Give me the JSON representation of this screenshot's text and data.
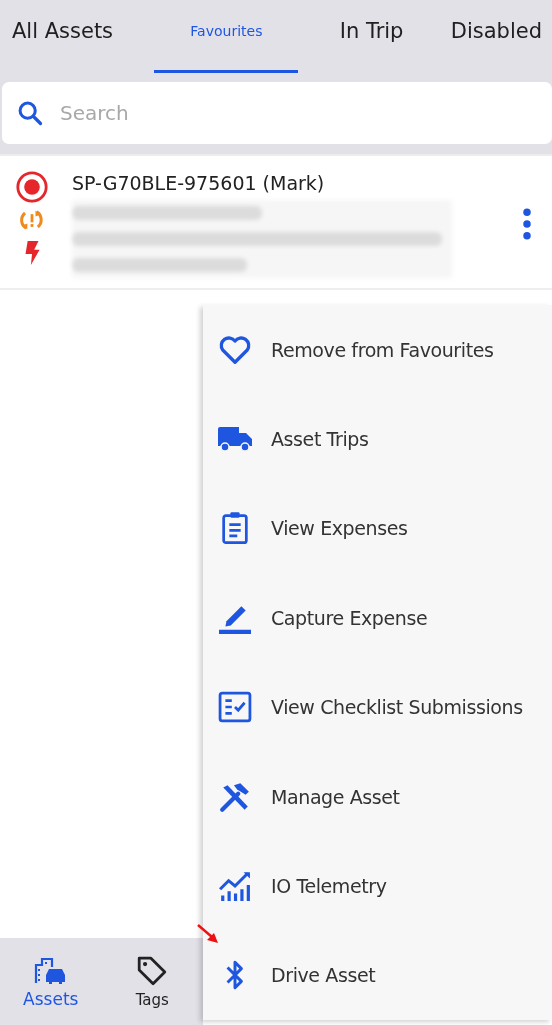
{
  "tabs": [
    {
      "label": "All Assets",
      "selected": false
    },
    {
      "label": "Favourites",
      "selected": true
    },
    {
      "label": "In Trip",
      "selected": false
    },
    {
      "label": "Disabled",
      "selected": false
    }
  ],
  "search": {
    "placeholder": "Search"
  },
  "asset": {
    "name": "SP-G70BLE-975601 (Mark)",
    "details": {
      "kind": "blurred"
    }
  },
  "menu": [
    {
      "kind": "heart",
      "label": "Remove from Favourites"
    },
    {
      "kind": "truck",
      "label": "Asset Trips"
    },
    {
      "kind": "clipboard",
      "label": "View Expenses"
    },
    {
      "kind": "pencil",
      "label": "Capture Expense"
    },
    {
      "kind": "checklist",
      "label": "View Checklist Submissions"
    },
    {
      "kind": "tools",
      "label": "Manage Asset"
    },
    {
      "kind": "chart",
      "label": "IO Telemetry"
    },
    {
      "kind": "bluetooth",
      "label": "Drive Asset"
    }
  ],
  "bottom_nav": [
    {
      "kind": "assets",
      "label": "Assets",
      "selected": true
    },
    {
      "kind": "tag",
      "label": "Tags",
      "selected": false
    }
  ]
}
